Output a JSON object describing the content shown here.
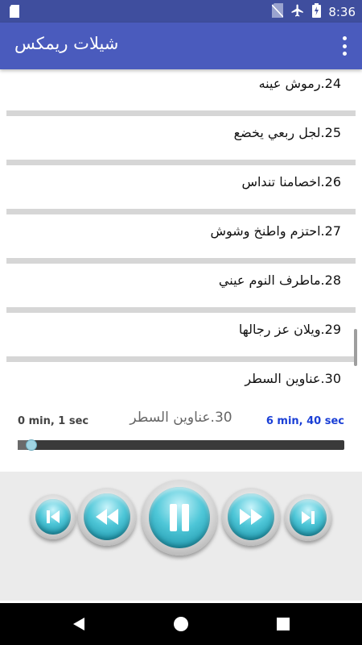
{
  "status_bar": {
    "time": "8:36",
    "icons": [
      "sd-card-icon",
      "no-sim-icon",
      "airplane-icon",
      "battery-charging-icon"
    ]
  },
  "app_bar": {
    "title": "شيلات ريمكس",
    "menu_icon": "overflow-menu-icon"
  },
  "tracks": [
    {
      "label": "24.رموش عينه"
    },
    {
      "label": "25.لجل ربعي يخضع"
    },
    {
      "label": "26.اخصامنا تنداس"
    },
    {
      "label": "27.احتزم واطنخ وشوش"
    },
    {
      "label": "28.ماطرف النوم عيني"
    },
    {
      "label": "29.ويلان عز رجالها"
    },
    {
      "label": "30.عناوين السطر"
    }
  ],
  "player": {
    "elapsed": "0 min, 1 sec",
    "now_playing": "30.عناوين السطر",
    "duration": "6 min, 40 sec",
    "progress": 0.004
  },
  "controls": {
    "buttons": [
      "skip-previous-icon",
      "rewind-icon",
      "pause-icon",
      "fast-forward-icon",
      "skip-next-icon"
    ]
  },
  "colors": {
    "status_bar": "#3f4e9e",
    "app_bar": "#4a5bbd",
    "accent": "#4fc7d8",
    "duration_text": "#1a3fd6"
  },
  "nav_bar": {
    "icons": [
      "back-icon",
      "home-icon",
      "recents-icon"
    ]
  }
}
